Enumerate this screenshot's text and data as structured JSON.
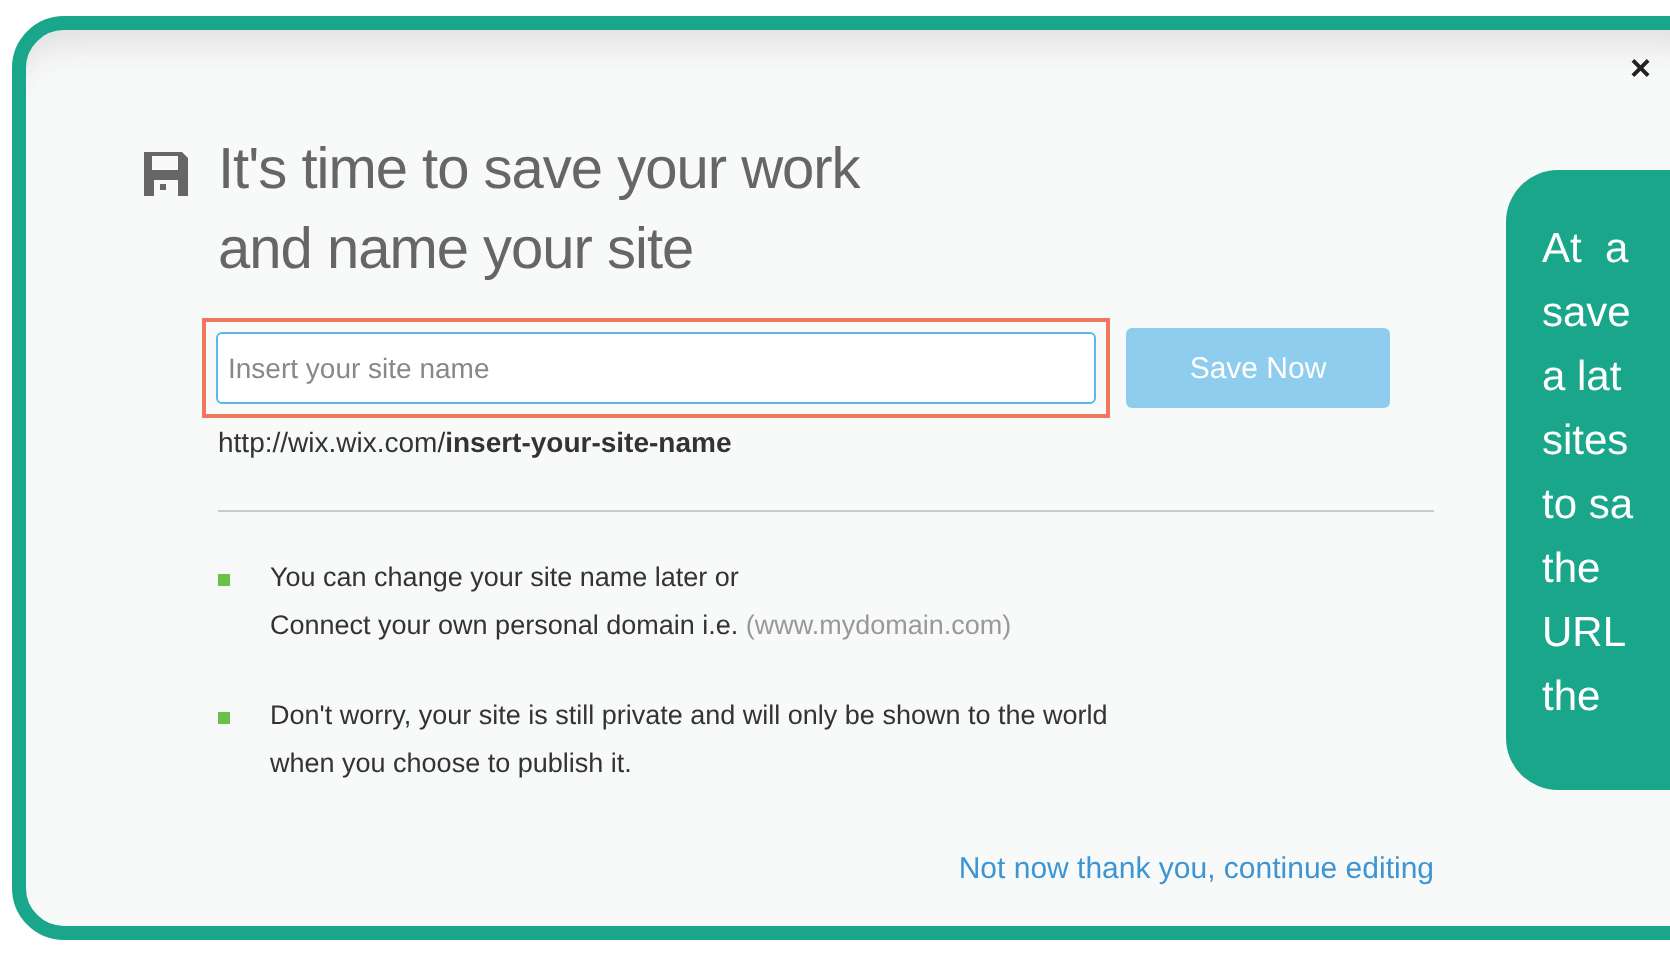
{
  "dialog": {
    "title_lines": [
      "It's time to save your work",
      "and name your site"
    ],
    "site_name_field": {
      "placeholder": "Insert your site name",
      "highlighted": true
    },
    "save_button": "Save Now",
    "url": {
      "prefix": "http://wix.wix.com/",
      "slug": "insert-your-site-name"
    },
    "bullets": [
      {
        "lines": [
          "You can change your site name later or",
          "Connect your own personal domain i.e."
        ],
        "note": "(www.mydomain.com)"
      },
      {
        "lines": [
          "Don't worry, your site is still private and will only be shown to the world",
          "when you choose to publish it."
        ]
      }
    ],
    "skip_link": "Not now thank you, continue editing",
    "close": "×"
  },
  "callout": {
    "lines": [
      "At  a",
      "save",
      "a lat",
      "sites",
      "to sa",
      "the",
      "URL",
      "the"
    ]
  }
}
